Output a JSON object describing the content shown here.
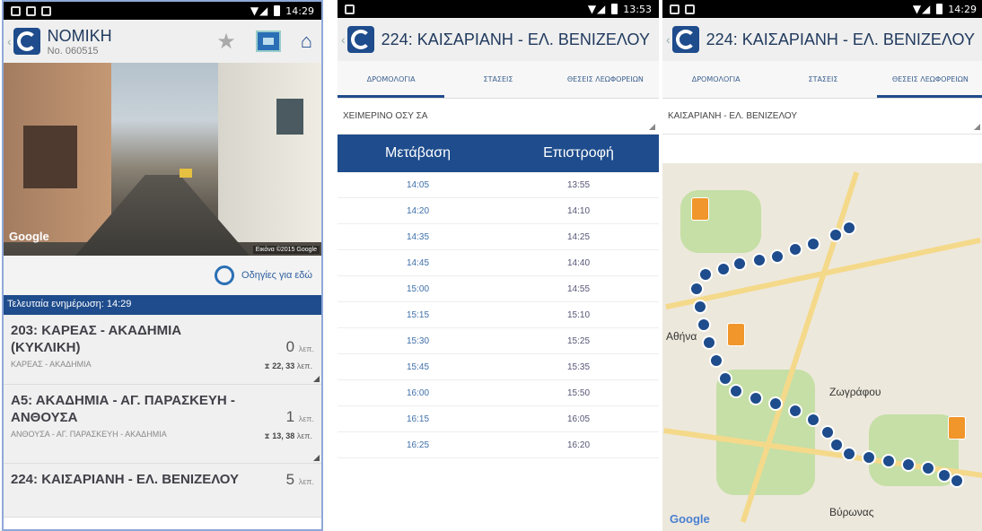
{
  "status": {
    "time1": "14:29",
    "time2": "13:53",
    "time3": "14:29"
  },
  "screen1": {
    "title": "ΝΟΜΙΚΗ",
    "subtitle": "No. 060515",
    "streetview_watermark": "Google",
    "streetview_credit": "Εικόνα ©2015 Google",
    "directions_label": "Οδηγίες για εδώ",
    "update_label": "Τελευταία ενημέρωση: 14:29",
    "routes": [
      {
        "title": "203: ΚΑΡΕΑΣ - ΑΚΑΔΗΜΙΑ (ΚΥΚΛΙΚΗ)",
        "subtitle": "ΚΑΡΕΑΣ - ΑΚΑΔΗΜΙΑ",
        "minutes": "0",
        "unit": "λεπ.",
        "next": "22, 33",
        "next_unit": "λεπ."
      },
      {
        "title": "Α5: ΑΚΑΔΗΜΙΑ - ΑΓ. ΠΑΡΑΣΚΕΥΗ - ΑΝΘΟΥΣΑ",
        "subtitle": "ΑΝΘΟΥΣΑ - ΑΓ. ΠΑΡΑΣΚΕΥΗ - ΑΚΑΔΗΜΙΑ",
        "minutes": "1",
        "unit": "λεπ.",
        "next": "13, 38",
        "next_unit": "λεπ."
      },
      {
        "title": "224: ΚΑΙΣΑΡΙΑΝΗ - ΕΛ. ΒΕΝΙΖΕΛΟΥ",
        "subtitle": "",
        "minutes": "5",
        "unit": "λεπ.",
        "next": "",
        "next_unit": ""
      }
    ]
  },
  "screen2": {
    "title": "224: ΚΑΙΣΑΡΙΑΝΗ - ΕΛ. ΒΕΝΙΖΕΛΟΥ",
    "tabs": [
      "ΔΡΟΜΟΛΟΓΙΑ",
      "ΣΤΑΣΕΙΣ",
      "ΘΕΣΕΙΣ ΛΕΩΦΟΡΕΙΩΝ"
    ],
    "schedule_select": "ΧΕΙΜΕΡΙΝΟ ΟΣΥ ΣΑ",
    "col_outbound": "Μετάβαση",
    "col_return": "Επιστροφή",
    "rows": [
      [
        "14:05",
        "13:55"
      ],
      [
        "14:20",
        "14:10"
      ],
      [
        "14:35",
        "14:25"
      ],
      [
        "14:45",
        "14:40"
      ],
      [
        "15:00",
        "14:55"
      ],
      [
        "15:15",
        "15:10"
      ],
      [
        "15:30",
        "15:25"
      ],
      [
        "15:45",
        "15:35"
      ],
      [
        "16:00",
        "15:50"
      ],
      [
        "16:15",
        "16:05"
      ],
      [
        "16:25",
        "16:20"
      ]
    ]
  },
  "screen3": {
    "title": "224: ΚΑΙΣΑΡΙΑΝΗ - ΕΛ. ΒΕΝΙΖΕΛΟΥ",
    "tabs": [
      "ΔΡΟΜΟΛΟΓΙΑ",
      "ΣΤΑΣΕΙΣ",
      "ΘΕΣΕΙΣ ΛΕΩΦΟΡΕΙΩΝ"
    ],
    "direction_select": "ΚΑΙΣΑΡΙΑΝΗ - ΕΛ. ΒΕΝΙΖΕΛΟΥ",
    "map_labels": [
      "Αθήνα",
      "Ζωγράφου",
      "Βύρωνας"
    ],
    "map_watermark": "Google"
  },
  "colors": {
    "brand": "#1e4c8c",
    "accent": "#f0962a"
  }
}
